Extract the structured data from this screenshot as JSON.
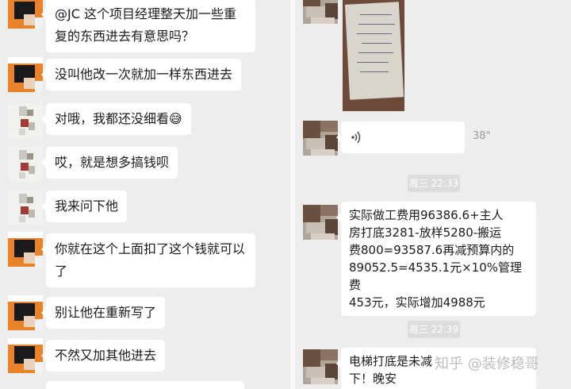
{
  "left_chat": {
    "messages": [
      {
        "avatar": "orange-pixel-avatar",
        "lines": [
          "@JC 这个项目经理整天加一些重",
          "复的东西进去有意思吗？"
        ]
      },
      {
        "avatar": "orange-pixel-avatar",
        "lines": [
          "没叫他改一次就加一样东西进去"
        ]
      },
      {
        "avatar": "light-pixel-avatar",
        "lines": [
          "对哦，我都还没细看😅"
        ]
      },
      {
        "avatar": "light-pixel-avatar",
        "lines": [
          "哎，就是想多搞钱呗"
        ]
      },
      {
        "avatar": "light-pixel-avatar",
        "lines": [
          "我来问下他"
        ]
      },
      {
        "avatar": "orange-pixel-avatar",
        "lines": [
          "你就在这个上面扣了这个钱就可以",
          "了"
        ]
      },
      {
        "avatar": "orange-pixel-avatar",
        "lines": [
          "别让他在重新写了"
        ]
      },
      {
        "avatar": "orange-pixel-avatar",
        "lines": [
          "不然又加其他进去"
        ]
      }
    ]
  },
  "right_chat": {
    "voice_duration": "38\"",
    "timestamps": [
      "周三 22:33",
      "周三 22:39"
    ],
    "cost_message_lines": [
      "实际做工费用96386.6+主人",
      "房打底3281-放样5280-搬运",
      "费800=93587.6再减预算内的",
      "89052.5=4535.1元×10%管理费",
      "453元，实际增加4988元"
    ],
    "elevator_message_lines": [
      "电梯打底是未减",
      "下！晚安"
    ],
    "watermark": "知乎 @装修稳哥"
  },
  "colors": {
    "background": "#ededed",
    "bubble": "#ffffff",
    "orange_avatar": "#e8832c"
  }
}
